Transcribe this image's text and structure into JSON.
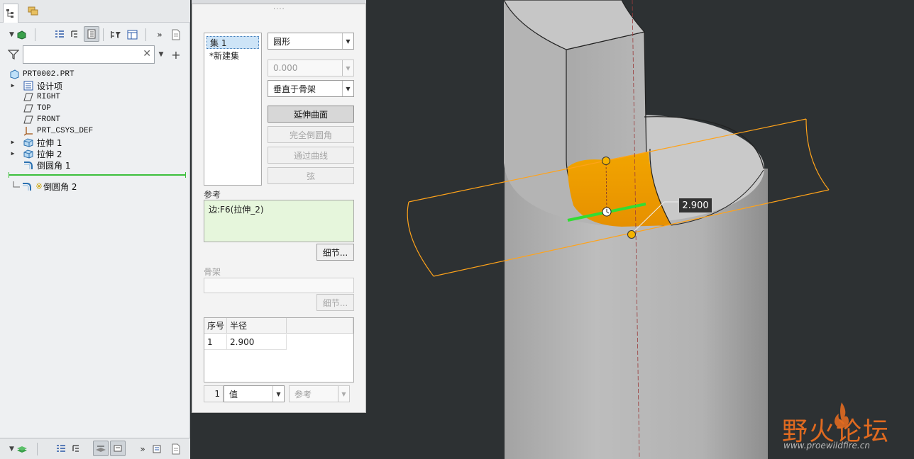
{
  "model_tree": {
    "filter_placeholder": "",
    "items": [
      {
        "label": "PRT0002.PRT",
        "icon": "part-icon"
      },
      {
        "label": "设计项",
        "icon": "design-items-icon"
      },
      {
        "label": "RIGHT",
        "icon": "datum-plane-icon"
      },
      {
        "label": "TOP",
        "icon": "datum-plane-icon"
      },
      {
        "label": "FRONT",
        "icon": "datum-plane-icon"
      },
      {
        "label": "PRT_CSYS_DEF",
        "icon": "csys-icon"
      },
      {
        "label": "拉伸 1",
        "icon": "extrude-icon"
      },
      {
        "label": "拉伸 2",
        "icon": "extrude-icon"
      },
      {
        "label": "倒圆角 1",
        "icon": "round-icon"
      },
      {
        "label": "倒圆角 2",
        "icon": "round-icon",
        "prefix": "※"
      }
    ]
  },
  "round_dialog": {
    "sets": [
      "集 1",
      "*新建集"
    ],
    "shape_combo": "圆形",
    "value_combo": "0.000",
    "direction_combo": "垂直于骨架",
    "buttons": {
      "extend_surface": "延伸曲面",
      "full_round": "完全倒圆角",
      "through_curve": "通过曲线",
      "chord": "弦"
    },
    "references_label": "参考",
    "references_value": "边:F6(拉伸_2)",
    "details_label": "细节...",
    "skeleton_label": "骨架",
    "skeleton_details_label": "细节...",
    "table": {
      "headers": [
        "序号",
        "半径"
      ],
      "rows": [
        [
          "1",
          "2.900"
        ]
      ]
    },
    "row_number": "1",
    "value_type_combo": "值",
    "reference_combo": "参考"
  },
  "viewport": {
    "dimension_value": "2.900",
    "accent_color": "#f0a000",
    "preview_outline_color": "#ffa31a"
  },
  "watermark": {
    "title": "野火论坛",
    "url": "www.proewildfire.cn"
  }
}
